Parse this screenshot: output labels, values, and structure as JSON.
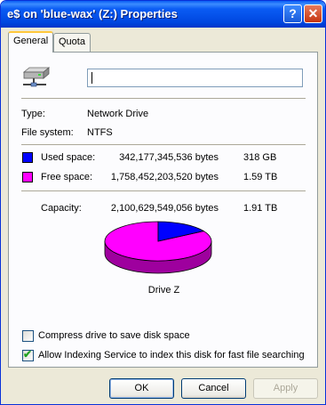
{
  "window": {
    "title": "e$ on 'blue-wax' (Z:) Properties",
    "help_glyph": "?",
    "close_glyph": "✕"
  },
  "tabs": [
    {
      "label": "General",
      "selected": true
    },
    {
      "label": "Quota",
      "selected": false
    }
  ],
  "general": {
    "drive_icon": "network-drive-icon",
    "label_value": "",
    "type_label": "Type:",
    "type_value": "Network Drive",
    "fs_label": "File system:",
    "fs_value": "NTFS",
    "used": {
      "label": "Used space:",
      "bytes": "342,177,345,536 bytes",
      "size": "318 GB",
      "color": "#0000ff",
      "fraction": 0.163
    },
    "free": {
      "label": "Free space:",
      "bytes": "1,758,452,203,520 bytes",
      "size": "1.59 TB",
      "color": "#ff00ff",
      "fraction": 0.837
    },
    "capacity": {
      "label": "Capacity:",
      "bytes": "2,100,629,549,056 bytes",
      "size": "1.91 TB"
    },
    "drive_caption": "Drive Z",
    "compress_label": "Compress drive to save disk space",
    "compress_checked": false,
    "index_label": "Allow Indexing Service to index this disk for fast file searching",
    "index_checked": true
  },
  "buttons": {
    "ok": "OK",
    "cancel": "Cancel",
    "apply": "Apply",
    "apply_enabled": false
  }
}
